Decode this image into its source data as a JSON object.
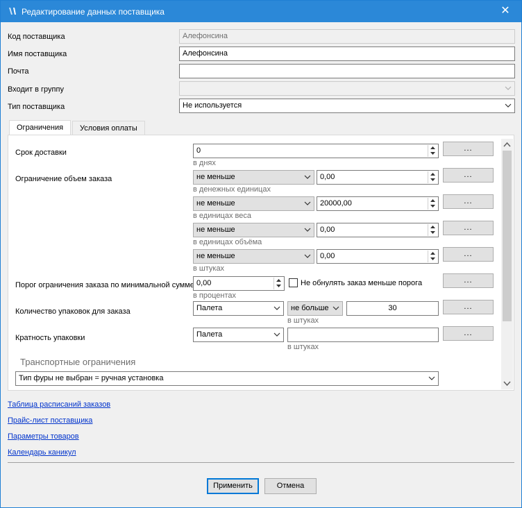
{
  "window": {
    "title": "Редактирование данных поставщика"
  },
  "fields": {
    "supplier_code": {
      "label": "Код поставщика",
      "value": "Алефонсина"
    },
    "supplier_name": {
      "label": "Имя поставщика",
      "value": "Алефонсина"
    },
    "email": {
      "label": "Почта",
      "value": ""
    },
    "group": {
      "label": "Входит в группу",
      "value": ""
    },
    "supplier_type": {
      "label": "Тип поставщика",
      "value": "Не используется"
    }
  },
  "tabs": [
    {
      "label": "Ограничения",
      "active": true
    },
    {
      "label": "Условия оплаты",
      "active": false
    }
  ],
  "restrictions": {
    "dots": "...",
    "delivery": {
      "label": "Срок доставки",
      "value": "0",
      "hint": "в днях"
    },
    "order_volume": {
      "label": "Ограничение объем заказа",
      "rows": [
        {
          "op": "не меньше",
          "value": "0,00",
          "hint": "в денежных единицах"
        },
        {
          "op": "не меньше",
          "value": "20000,00",
          "hint": "в единицах веса"
        },
        {
          "op": "не меньше",
          "value": "0,00",
          "hint": "в единицах объёма"
        },
        {
          "op": "не меньше",
          "value": "0,00",
          "hint": "в штуках"
        }
      ]
    },
    "min_sum": {
      "label": "Порог ограничения заказа по минимальной сумме",
      "value": "0,00",
      "hint": "в процентах",
      "checkbox_label": "Не обнулять заказ меньше порога",
      "checked": false
    },
    "pack_count": {
      "label": "Количество упаковок для заказа",
      "pack": "Палета",
      "op": "не больше",
      "value": "30",
      "hint": "в штуках"
    },
    "pack_multiple": {
      "label": "Кратность упаковки",
      "pack": "Палета",
      "value": "",
      "hint": "в штуках"
    },
    "transport": {
      "title": "Транспортные ограничения",
      "value": "Тип фуры не выбран = ручная установка"
    }
  },
  "links": [
    "Таблица расписаний заказов",
    "Прайс-лист поставщика",
    "Параметры товаров",
    "Календарь каникул"
  ],
  "buttons": {
    "apply": "Применить",
    "cancel": "Отмена"
  }
}
